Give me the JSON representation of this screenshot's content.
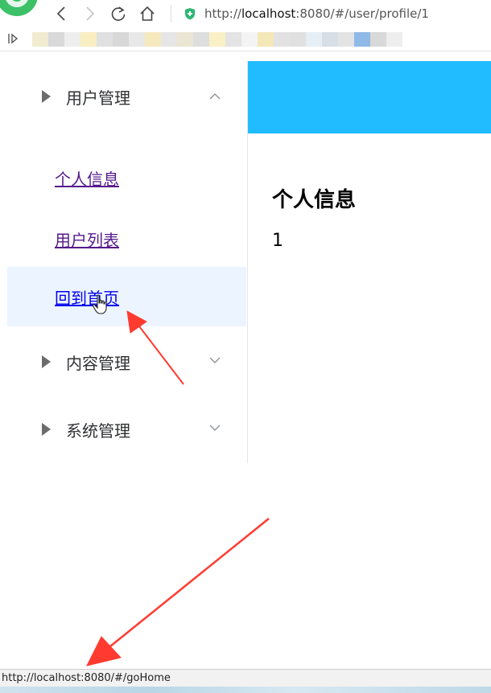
{
  "browser": {
    "url": {
      "scheme": "http://",
      "host": "localhost",
      "rest": ":8080/#/user/profile/1"
    },
    "bookmark_colors": [
      "#f1ecd0",
      "#d9d9d9",
      "#eeeeee",
      "#f8eec2",
      "#e0e0e0",
      "#d8d8d8",
      "#e8e8e8",
      "#f5e9bd",
      "#e6e6e6",
      "#ebe5d3",
      "#dedede",
      "#faf0c6",
      "#e4e4e4",
      "#f4f4f4",
      "#f5e8b8",
      "#e2e2e2",
      "#e0e0e0",
      "#e6eef6",
      "#d7dee6",
      "#e3e3e3",
      "#8fb9e6",
      "#d9d9d9",
      "#eeeeee"
    ]
  },
  "sidebar": {
    "groups": [
      {
        "label": "用户管理",
        "expanded": true
      },
      {
        "label": "内容管理",
        "expanded": false
      },
      {
        "label": "系统管理",
        "expanded": false
      }
    ],
    "items": [
      {
        "label": "个人信息",
        "active": false
      },
      {
        "label": "用户列表",
        "active": false
      },
      {
        "label": "回到首页",
        "active": true
      }
    ]
  },
  "main": {
    "header_color": "#21bcff",
    "title": "个人信息",
    "value": "1"
  },
  "statusbar": {
    "link": "http://localhost:8080/#/goHome"
  },
  "annotation_color": "#ff3b30"
}
